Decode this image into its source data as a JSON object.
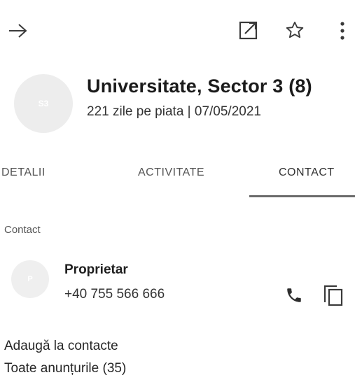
{
  "toolbar": {
    "back_icon": "arrow-right-icon",
    "edit_icon": "open-external-icon",
    "favorite_icon": "star-outline-icon",
    "more_icon": "more-vertical-icon"
  },
  "listing": {
    "avatar_initials": "S3",
    "title": "Universitate, Sector 3 (8)",
    "subtitle": "221 zile pe piata | 07/05/2021"
  },
  "tabs": [
    {
      "label": "DETALII",
      "active": false
    },
    {
      "label": "ACTIVITATE",
      "active": false
    },
    {
      "label": "CONTACT",
      "active": true
    }
  ],
  "contact_section": {
    "label": "Contact",
    "avatar_initial": "P",
    "name": "Proprietar",
    "phone": "+40 755 566 666",
    "call_icon": "phone-icon",
    "copy_icon": "copy-icon"
  },
  "links": {
    "add_contacts": "Adaugă la contacte",
    "all_listings": "Toate anunțurile (35)"
  },
  "colors": {
    "background": "#ffffff",
    "text": "#212121",
    "tab_indicator": "#6b6b6b",
    "avatar": "#ededed"
  }
}
